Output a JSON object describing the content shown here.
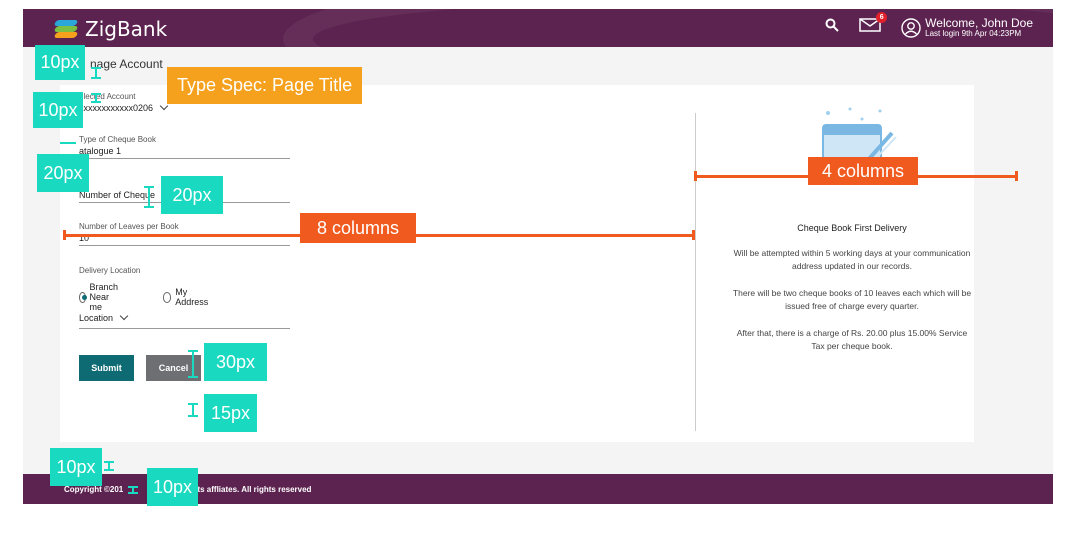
{
  "header": {
    "brand": "ZigBank",
    "mail_badge": "6",
    "welcome": "Welcome, John Doe",
    "last_login": "Last login 9th Apr 04:23PM"
  },
  "page_title": "nage Account",
  "form": {
    "account_label": "elected Account",
    "account_value": "xxxxxxxxxxxx0206",
    "cheque_type_label": "Type of Cheque Book",
    "cheque_type_value": "atalogue 1",
    "num_cheque_label": "Number of Cheque",
    "leaves_label": "Number of Leaves per Book",
    "leaves_value": "10",
    "delivery_label": "Delivery Location",
    "radio_branch": "Branch Near me",
    "radio_address": "My Address",
    "location_label": "Location",
    "submit_label": "Submit",
    "cancel_label": "Cancel"
  },
  "info": {
    "title": "Cheque Book First Delivery",
    "p1": "Will be attempted within 5 working days at your communication address updated in our records.",
    "p2": "There will be two cheque books of 10 leaves each which will be issued free of charge every quarter.",
    "p3": "After that, there is a charge of Rs. 20.00 plus 15.00% Service Tax per cheque book."
  },
  "footer": {
    "copyright_left": "Copyright ©201",
    "copyright_right": "its affliates. All rights reserved"
  },
  "annotations": {
    "page_title_spec": "Type Spec: Page Title",
    "eight_columns": "8 columns",
    "four_columns": "4 columns",
    "a_10px_1": "10px",
    "a_10px_2": "10px",
    "a_20px_1": "20px",
    "a_20px_2": "20px",
    "a_30px": "30px",
    "a_15px": "15px",
    "a_10px_3": "10px",
    "a_10px_4": "10px"
  },
  "colors": {
    "header_bg": "#5c2350",
    "primary_button": "#0e6b74",
    "secondary_button": "#6e6f73",
    "annotation_teal": "#19d9c0",
    "annotation_orange": "#f5a11d",
    "annotation_red": "#f05a1f"
  }
}
